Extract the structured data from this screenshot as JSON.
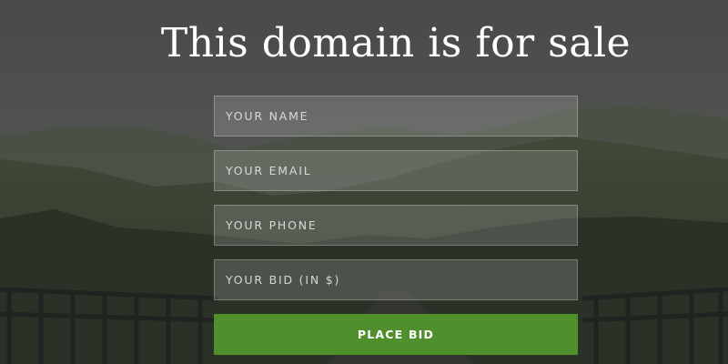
{
  "page": {
    "headline": "This domain is for sale"
  },
  "form": {
    "name_placeholder": "YOUR NAME",
    "email_placeholder": "YOUR EMAIL",
    "phone_placeholder": "YOUR PHONE",
    "bid_placeholder": "YOUR BID (IN $)",
    "submit_label": "PLACE BID"
  },
  "colors": {
    "accent": "#4f8f2c",
    "headline": "#ffffff"
  }
}
